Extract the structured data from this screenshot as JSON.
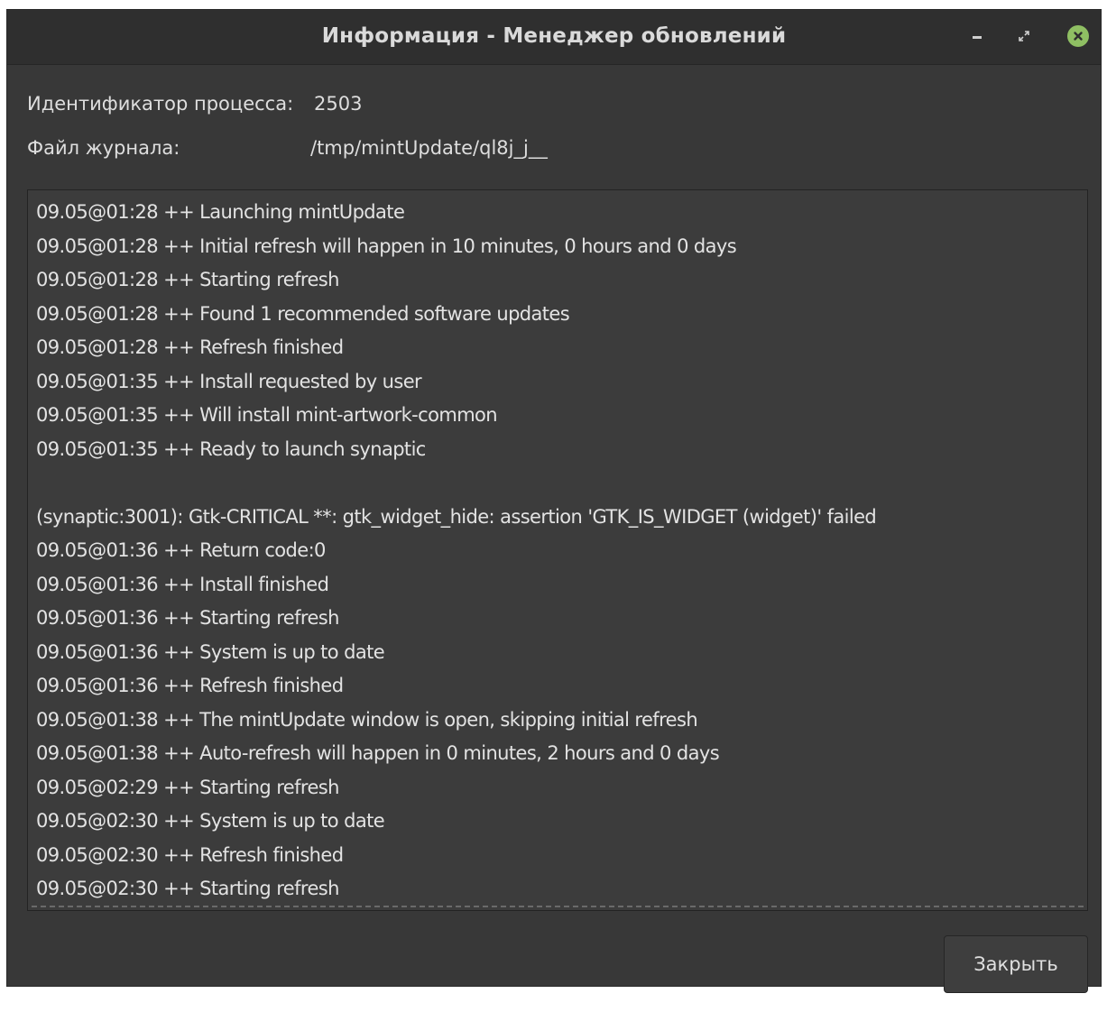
{
  "window": {
    "title": "Информация - Менеджер обновлений"
  },
  "info": {
    "pid_label": "Идентификатор процесса:",
    "pid_value": "2503",
    "logfile_label": "Файл журнала:",
    "logfile_value": "/tmp/mintUpdate/ql8j_j__"
  },
  "log": {
    "lines": [
      "09.05@01:28 ++ Launching mintUpdate",
      "09.05@01:28 ++ Initial refresh will happen in 10 minutes, 0 hours and 0 days",
      "09.05@01:28 ++ Starting refresh",
      "09.05@01:28 ++ Found 1 recommended software updates",
      "09.05@01:28 ++ Refresh finished",
      "09.05@01:35 ++ Install requested by user",
      "09.05@01:35 ++ Will install mint-artwork-common",
      "09.05@01:35 ++ Ready to launch synaptic",
      "",
      "(synaptic:3001): Gtk-CRITICAL **: gtk_widget_hide: assertion 'GTK_IS_WIDGET (widget)' failed",
      "09.05@01:36 ++ Return code:0",
      "09.05@01:36 ++ Install finished",
      "09.05@01:36 ++ Starting refresh",
      "09.05@01:36 ++ System is up to date",
      "09.05@01:36 ++ Refresh finished",
      "09.05@01:38 ++ The mintUpdate window is open, skipping initial refresh",
      "09.05@01:38 ++ Auto-refresh will happen in 0 minutes, 2 hours and 0 days",
      "09.05@02:29 ++ Starting refresh",
      "09.05@02:30 ++ System is up to date",
      "09.05@02:30 ++ Refresh finished",
      "09.05@02:30 ++ Starting refresh"
    ]
  },
  "buttons": {
    "close_label": "Закрыть"
  },
  "icons": {
    "minimize": "minimize-icon",
    "maximize": "maximize-icon",
    "close": "close-icon"
  },
  "colors": {
    "background": "#383838",
    "titlebar": "#2f2f2f",
    "close_accent": "#8fbf63",
    "text": "#e3e3e3"
  }
}
